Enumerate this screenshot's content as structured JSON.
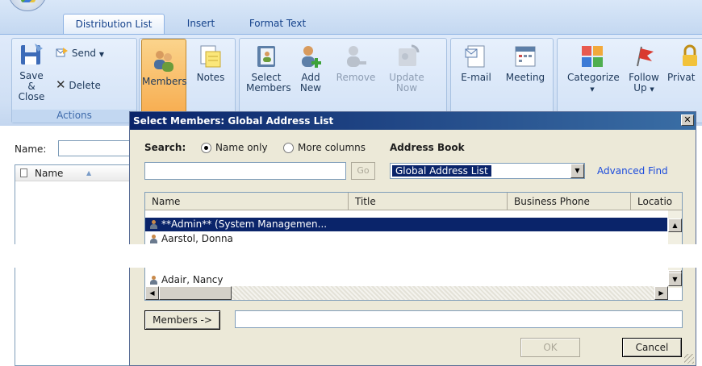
{
  "ribbon": {
    "tabs": [
      {
        "label": "Distribution List",
        "active": true
      },
      {
        "label": "Insert",
        "active": false
      },
      {
        "label": "Format Text",
        "active": false
      }
    ],
    "actions": {
      "save_close": "Save & Close",
      "send": "Send",
      "delete": "Delete",
      "group_label": "Actions"
    },
    "members": "Members",
    "notes": "Notes",
    "select_members": "Select Members",
    "add_new": "Add New",
    "remove": "Remove",
    "update_now": "Update Now",
    "email": "E-mail",
    "meeting": "Meeting",
    "categorize": "Categorize",
    "follow_up": "Follow Up",
    "private": "Privat"
  },
  "form": {
    "name_label": "Name:",
    "list_column": "Name"
  },
  "dialog": {
    "title": "Select Members: Global Address List",
    "close_glyph": "✕",
    "search_label": "Search:",
    "radio_name_only": "Name only",
    "radio_more_columns": "More columns",
    "address_book_label": "Address Book",
    "search_value": "",
    "go_label": "Go",
    "address_book_value": "Global Address List",
    "advanced_find": "Advanced Find",
    "columns": [
      "Name",
      "Title",
      "Business Phone",
      "Locatio"
    ],
    "rows": [
      {
        "name": "**Admin** (System Managemen...",
        "selected": true
      },
      {
        "name": "Aarstol, Donna",
        "selected": false
      },
      {
        "name": "Adair, Nancy",
        "selected": false
      }
    ],
    "members_button": "Members ->",
    "members_value": "",
    "ok": "OK",
    "cancel": "Cancel"
  },
  "colors": {
    "selection": "#0a246a",
    "link": "#1b4bdc",
    "ribbon_text": "#1e395b"
  }
}
